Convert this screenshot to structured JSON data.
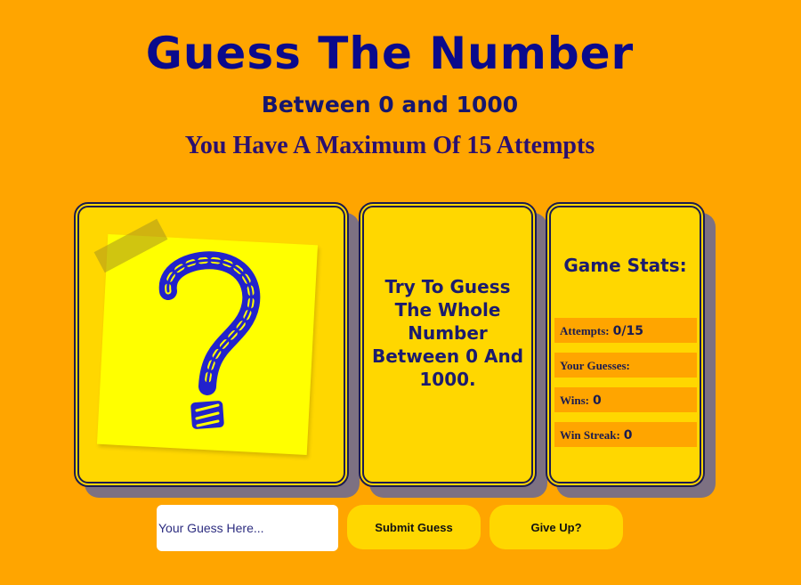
{
  "header": {
    "title": "Guess The Number",
    "subtitle": "Between 0 and 1000",
    "attempts_text": "You Have A Maximum Of 15 Attempts"
  },
  "instructions": {
    "text": "Try To Guess The Whole Number Between 0 And 1000."
  },
  "stats": {
    "title": "Game Stats:",
    "attempts_label": "Attempts:",
    "attempts_value": "0/15",
    "guesses_label": "Your Guesses:",
    "guesses_value": "",
    "wins_label": "Wins:",
    "wins_value": "0",
    "streak_label": "Win Streak:",
    "streak_value": "0"
  },
  "controls": {
    "guess_placeholder": "Your Guess Here...",
    "submit_label": "Submit Guess",
    "giveup_label": "Give Up?"
  },
  "icons": {
    "question": "question-mark-icon"
  },
  "colors": {
    "background": "#FFA500",
    "card": "#FFD700",
    "sticky_note": "#FFFF00",
    "text_dark": "#0A0A8C",
    "question_mark": "#2222CC"
  }
}
